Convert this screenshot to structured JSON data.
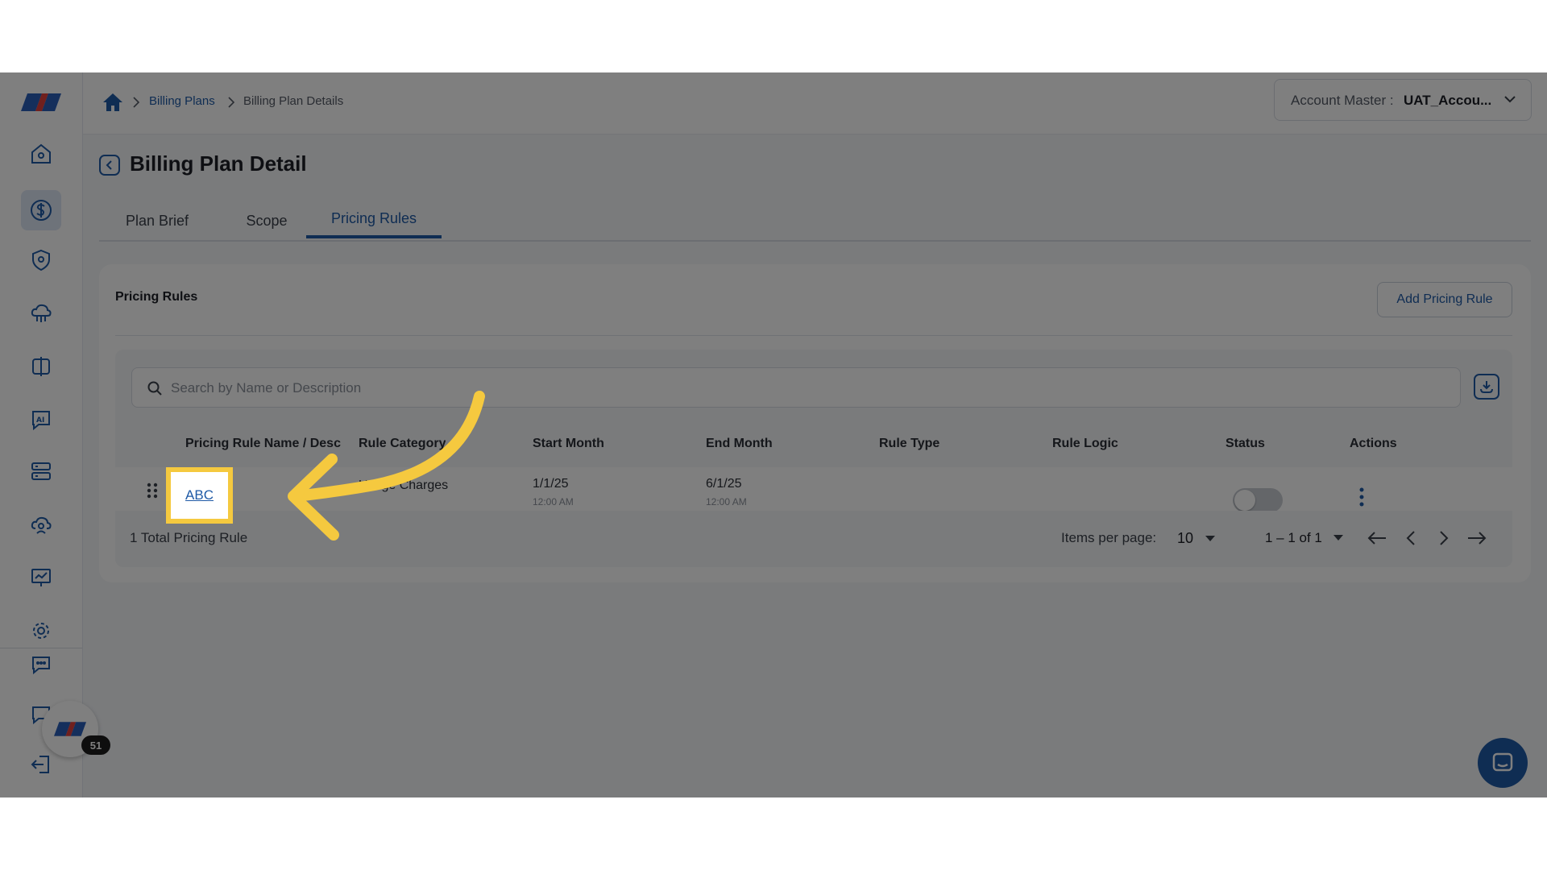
{
  "breadcrumb": {
    "items": [
      {
        "label": "Billing Plans"
      },
      {
        "label": "Billing Plan Details"
      }
    ]
  },
  "account": {
    "label": "Account Master :",
    "value": "UAT_Accou..."
  },
  "page": {
    "title": "Billing Plan Detail"
  },
  "tabs": [
    {
      "label": "Plan Brief",
      "active": false
    },
    {
      "label": "Scope",
      "active": false
    },
    {
      "label": "Pricing Rules",
      "active": true
    }
  ],
  "card": {
    "title": "Pricing Rules",
    "add_button": "Add Pricing Rule"
  },
  "search": {
    "placeholder": "Search by Name or Description",
    "value": ""
  },
  "table": {
    "columns": [
      "Pricing Rule Name / Desc",
      "Rule Category",
      "Start Month",
      "End Month",
      "Rule Type",
      "Rule Logic",
      "Status",
      "Actions"
    ],
    "rows": [
      {
        "name": "ABC",
        "category": "Usage Charges",
        "start_date": "1/1/25",
        "start_time": "12:00 AM",
        "end_date": "6/1/25",
        "end_time": "12:00 AM",
        "rule_type": "",
        "rule_logic": "",
        "status_on": false
      }
    ]
  },
  "footer": {
    "total": "1 Total Pricing Rule",
    "items_per_page_label": "Items per page:",
    "items_per_page_value": "10",
    "range": "1 – 1 of 1"
  },
  "support": {
    "badge_count": "51"
  },
  "colors": {
    "primary": "#1f5aa6",
    "highlight": "#f5c93f",
    "overlay": "rgba(0,0,0,0.5)"
  },
  "icons": {
    "sidebar": [
      "home-icon",
      "dollar-icon",
      "shield-icon",
      "cloud-network-icon",
      "split-panel-icon",
      "ai-chat-icon",
      "server-icon",
      "cloud-user-icon",
      "presentation-chart-icon",
      "gear-icon",
      "chat-settings-icon",
      "chat-help-icon",
      "logout-icon"
    ]
  }
}
